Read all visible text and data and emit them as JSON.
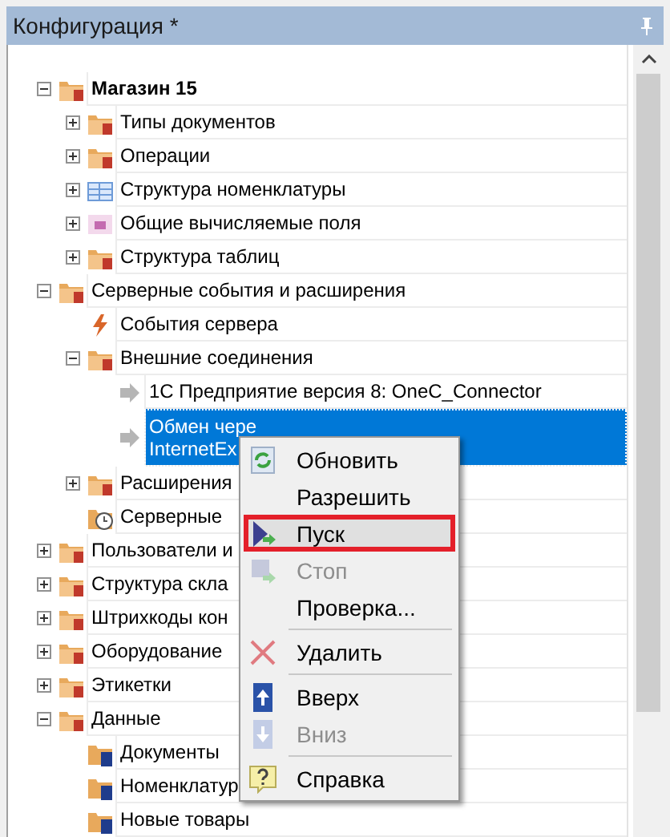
{
  "panel": {
    "title": "Конфигурация *"
  },
  "tree": [
    {
      "label": "Магазин 15",
      "kind": "group",
      "bold": true,
      "expanded": true,
      "selected": false,
      "children": [
        {
          "label": "Типы документов",
          "kind": "group",
          "expanded": false,
          "selected": false
        },
        {
          "label": "Операции",
          "kind": "group",
          "expanded": false,
          "selected": false
        },
        {
          "label": "Структура номенклатуры",
          "kind": "table",
          "expanded": false,
          "selected": false
        },
        {
          "label": "Общие вычисляемые поля",
          "kind": "field",
          "expanded": false,
          "selected": false
        },
        {
          "label": "Структура таблиц",
          "kind": "group",
          "expanded": false,
          "selected": false
        }
      ]
    },
    {
      "label": "Серверные события и расширения",
      "kind": "group",
      "expanded": true,
      "selected": false,
      "children": [
        {
          "label": "События сервера",
          "kind": "event",
          "selected": false
        },
        {
          "label": "Внешние соединения",
          "kind": "group",
          "expanded": true,
          "selected": false,
          "children": [
            {
              "label": "1С Предприятие версия 8: OneC_Connector",
              "kind": "connector",
              "selected": false
            },
            {
              "label": "Обмен чере\nInternetEx",
              "kind": "connector",
              "selected": true
            }
          ]
        },
        {
          "label": "Расширения",
          "kind": "group",
          "expanded": false,
          "selected": false
        },
        {
          "label": "Серверные",
          "kind": "schedule",
          "selected": false
        }
      ]
    },
    {
      "label": "Пользователи и",
      "kind": "group",
      "expanded": false,
      "selected": false
    },
    {
      "label": "Структура скла",
      "kind": "group",
      "expanded": false,
      "selected": false
    },
    {
      "label": "Штрихкоды кон",
      "kind": "group",
      "expanded": false,
      "selected": false
    },
    {
      "label": "Оборудование",
      "kind": "group",
      "expanded": false,
      "selected": false
    },
    {
      "label": "Этикетки",
      "kind": "group",
      "expanded": false,
      "selected": false
    },
    {
      "label": "Данные",
      "kind": "group",
      "expanded": true,
      "selected": false,
      "children": [
        {
          "label": "Документы",
          "kind": "document",
          "selected": false
        },
        {
          "label": "Номенклатур",
          "kind": "document",
          "selected": false
        },
        {
          "label": "Новые товары",
          "kind": "document",
          "selected": false
        }
      ]
    }
  ],
  "context_menu": [
    {
      "kind": "refresh",
      "label": "Обновить",
      "disabled": false,
      "highlighted": false
    },
    {
      "kind": "plain",
      "label": "Разрешить",
      "disabled": false,
      "highlighted": false
    },
    {
      "kind": "start",
      "label": "Пуск",
      "disabled": false,
      "highlighted": true
    },
    {
      "kind": "stop",
      "label": "Стоп",
      "disabled": true,
      "highlighted": false
    },
    {
      "kind": "plain",
      "label": "Проверка...",
      "disabled": false,
      "highlighted": false
    },
    {
      "kind": "separator"
    },
    {
      "kind": "delete",
      "label": "Удалить",
      "disabled": false,
      "highlighted": false
    },
    {
      "kind": "separator"
    },
    {
      "kind": "up",
      "label": "Вверх",
      "disabled": false,
      "highlighted": false
    },
    {
      "kind": "down",
      "label": "Вниз",
      "disabled": true,
      "highlighted": false
    },
    {
      "kind": "separator"
    },
    {
      "kind": "help",
      "label": "Справка",
      "disabled": false,
      "highlighted": false
    }
  ]
}
